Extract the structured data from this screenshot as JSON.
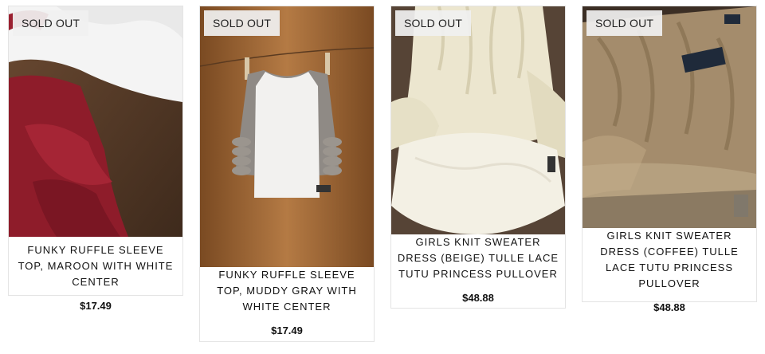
{
  "products": [
    {
      "title": "Funky Ruffle Sleeve Top, Maroon with White Center",
      "price": "$17.49",
      "badge": "SOLD OUT",
      "image": "maroon-ruffle-top-photo"
    },
    {
      "title": "Funky Ruffle Sleeve Top, Muddy Gray with White Center",
      "price": "$17.49",
      "badge": "SOLD OUT",
      "image": "gray-ruffle-top-on-clothesline-photo"
    },
    {
      "title": "Girls Knit Sweater Dress (Beige) Tulle Lace Tutu Princess Pullover",
      "price": "$48.88",
      "badge": "SOLD OUT",
      "image": "beige-sweater-dress-photo"
    },
    {
      "title": "Girls Knit Sweater Dress (Coffee) Tulle Lace Tutu Princess Pullover",
      "price": "$48.88",
      "badge": "SOLD OUT",
      "image": "coffee-sweater-dress-photo"
    }
  ],
  "colors": {
    "badge_bg": "#f0f0f0",
    "border": "#e4e4e4",
    "text": "#111111"
  }
}
